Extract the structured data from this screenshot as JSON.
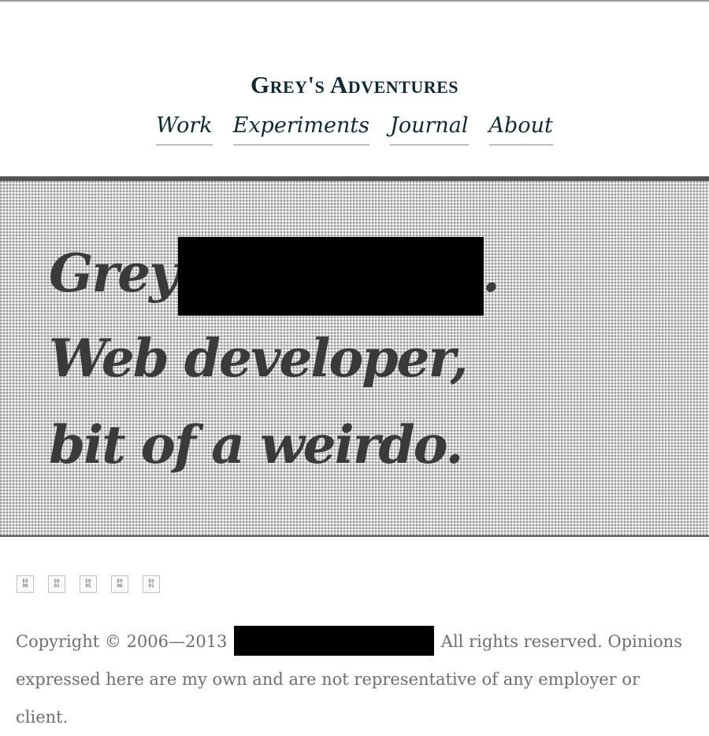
{
  "site": {
    "title": "Grey's Adventures"
  },
  "nav": [
    {
      "label": "Work"
    },
    {
      "label": "Experiments"
    },
    {
      "label": "Journal"
    },
    {
      "label": "About"
    }
  ],
  "hero": {
    "line1_start": "Grey",
    "line1_end": ".",
    "line2": "Web developer,",
    "line3": "bit of a weirdo."
  },
  "social_icons": [
    {
      "name": "social-icon-e000",
      "top": "E0",
      "bottom": "00"
    },
    {
      "name": "social-icon-e002",
      "top": "E0",
      "bottom": "02"
    },
    {
      "name": "social-icon-e005",
      "top": "E0",
      "bottom": "05"
    },
    {
      "name": "social-icon-e006",
      "top": "E0",
      "bottom": "06"
    },
    {
      "name": "social-icon-e001",
      "top": "E0",
      "bottom": "01"
    }
  ],
  "footer": {
    "copyright_prefix": "Copyright © 2006—2013",
    "copyright_suffix": "All rights reserved. Opinions expressed here are my own and are not representative of any employer or client."
  }
}
